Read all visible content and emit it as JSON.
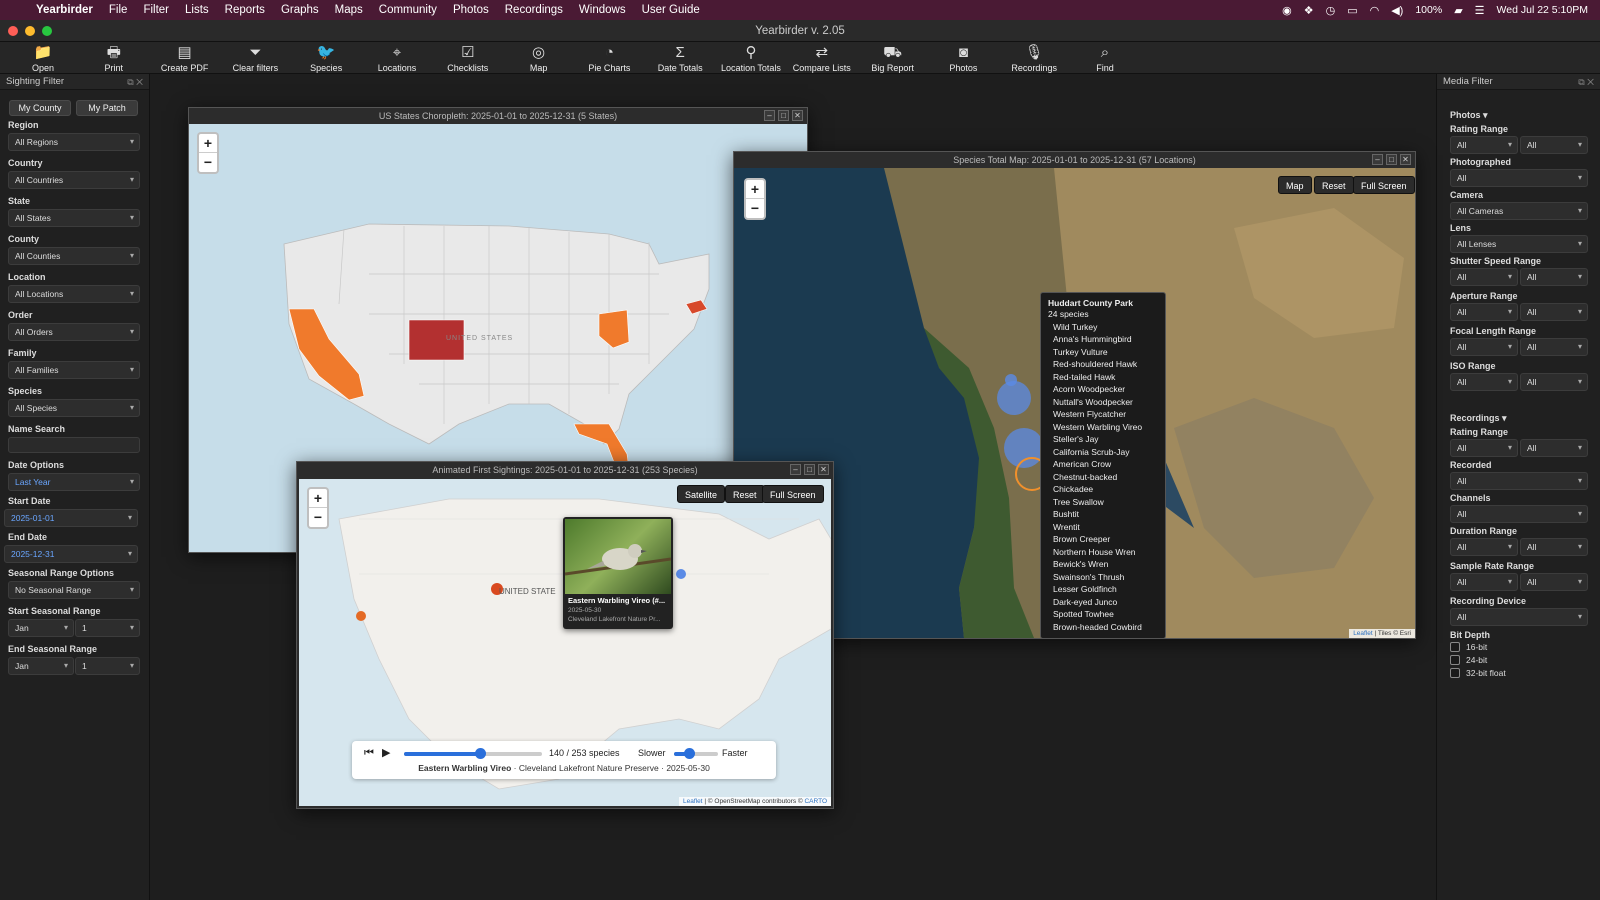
{
  "menubar": {
    "app": "Yearbirder",
    "items": [
      "File",
      "Filter",
      "Lists",
      "Reports",
      "Graphs",
      "Maps",
      "Community",
      "Photos",
      "Recordings",
      "Windows",
      "User Guide"
    ],
    "battery": "100%",
    "clock": "Wed Jul 22  5:10PM"
  },
  "window_title": "Yearbirder v. 2.05",
  "toolbar": [
    {
      "label": "Open",
      "icon": "📁"
    },
    {
      "label": "Print",
      "icon": "🖶"
    },
    {
      "label": "Create PDF",
      "icon": "▤"
    },
    {
      "label": "Clear filters",
      "icon": "⏷"
    },
    {
      "label": "Species",
      "icon": "🐦"
    },
    {
      "label": "Locations",
      "icon": "⌖"
    },
    {
      "label": "Checklists",
      "icon": "☑"
    },
    {
      "label": "Map",
      "icon": "◎"
    },
    {
      "label": "Pie Charts",
      "icon": "◔"
    },
    {
      "label": "Date Totals",
      "icon": "Σ"
    },
    {
      "label": "Location Totals",
      "icon": "⚲"
    },
    {
      "label": "Compare Lists",
      "icon": "⇄"
    },
    {
      "label": "Big Report",
      "icon": "⛟"
    },
    {
      "label": "Photos",
      "icon": "◙"
    },
    {
      "label": "Recordings",
      "icon": "🎙"
    },
    {
      "label": "Find",
      "icon": "⌕"
    }
  ],
  "sighting_filter": {
    "title": "Sighting Filter",
    "my_county": "My County",
    "my_patch": "My Patch",
    "region_label": "Region",
    "region": "All Regions",
    "country_label": "Country",
    "country": "All Countries",
    "state_label": "State",
    "state": "All States",
    "county_label": "County",
    "county": "All Counties",
    "location_label": "Location",
    "location": "All Locations",
    "order_label": "Order",
    "order": "All Orders",
    "family_label": "Family",
    "family": "All Families",
    "species_label": "Species",
    "species": "All Species",
    "name_search_label": "Name Search",
    "date_options_label": "Date Options",
    "date_options": "Last Year",
    "start_date_label": "Start Date",
    "start_date": "2025-01-01",
    "end_date_label": "End Date",
    "end_date": "2025-12-31",
    "seasonal_options_label": "Seasonal Range Options",
    "seasonal_options": "No Seasonal Range",
    "start_seasonal_label": "Start Seasonal Range",
    "start_month": "Jan",
    "start_day": "1",
    "end_seasonal_label": "End Seasonal Range",
    "end_month": "Jan",
    "end_day": "1"
  },
  "media_filter": {
    "title": "Media Filter",
    "photos_header": "Photos ▾",
    "rating_range_label": "Rating Range",
    "all": "All",
    "photographed_label": "Photographed",
    "camera_label": "Camera",
    "camera": "All Cameras",
    "lens_label": "Lens",
    "lens": "All Lenses",
    "shutter_label": "Shutter Speed Range",
    "aperture_label": "Aperture Range",
    "focal_label": "Focal Length Range",
    "iso_label": "ISO Range",
    "recordings_header": "Recordings ▾",
    "rec_rating_label": "Rating Range",
    "recorded_label": "Recorded",
    "channels_label": "Channels",
    "duration_label": "Duration Range",
    "sample_rate_label": "Sample Rate Range",
    "device_label": "Recording Device",
    "bit_depth_label": "Bit Depth",
    "bit_depths": [
      "16-bit",
      "24-bit",
      "32-bit float"
    ]
  },
  "choropleth": {
    "title": "US States Choropleth: 2025-01-01 to 2025-12-31 (5 States)",
    "country_label": "UNITED STATES",
    "highlighted_states": [
      {
        "name": "California",
        "color": "#f07a2c"
      },
      {
        "name": "Colorado",
        "color": "#b33030"
      },
      {
        "name": "Ohio",
        "color": "#f07a2c"
      },
      {
        "name": "Florida",
        "color": "#f07a2c"
      },
      {
        "name": "Massachusetts",
        "color": "#d7492b"
      }
    ]
  },
  "species_map": {
    "title": "Species Total Map: 2025-01-01 to 2025-12-31 (57 Locations)",
    "btn_map": "Map",
    "btn_reset": "Reset",
    "btn_full": "Full Screen",
    "attribution_leaflet": "Leaflet",
    "attribution_tiles": "| Tiles © Esri",
    "tooltip": {
      "title": "Huddart County Park",
      "count": "24 species",
      "species": [
        "Wild Turkey",
        "Anna's Hummingbird",
        "Turkey Vulture",
        "Red-shouldered Hawk",
        "Red-tailed Hawk",
        "Acorn Woodpecker",
        "Nuttall's Woodpecker",
        "Western Flycatcher",
        "Western Warbling Vireo",
        "Steller's Jay",
        "California Scrub-Jay",
        "American Crow",
        "Chestnut-backed Chickadee",
        "Tree Swallow",
        "Bushtit",
        "Wrentit",
        "Brown Creeper",
        "Northern House Wren",
        "Bewick's Wren",
        "Swainson's Thrush",
        "Lesser Goldfinch",
        "Dark-eyed Junco",
        "Spotted Towhee",
        "Brown-headed Cowbird"
      ]
    }
  },
  "animated": {
    "title": "Animated First Sightings: 2025-01-01 to 2025-12-31 (253 Species)",
    "btn_satellite": "Satellite",
    "btn_reset": "Reset",
    "btn_full": "Full Screen",
    "country_label": "UNITED STATE",
    "popup_title": "Eastern Warbling Vireo (#...",
    "popup_date": "2025-05-30",
    "popup_loc": "Cleveland Lakefront Nature Pr...",
    "progress_fraction": 0.553,
    "speed_fraction": 0.35,
    "count_text": "140 / 253 species",
    "slower": "Slower",
    "faster": "Faster",
    "current_species": "Eastern Warbling Vireo",
    "current_location": "Cleveland Lakefront Nature Preserve",
    "current_date": "2025-05-30",
    "sep": "·",
    "attribution_leaflet": "Leaflet",
    "attribution_osm": "| © OpenStreetMap",
    "attribution_rest": "contributors ©",
    "attribution_carto": "CARTO"
  }
}
